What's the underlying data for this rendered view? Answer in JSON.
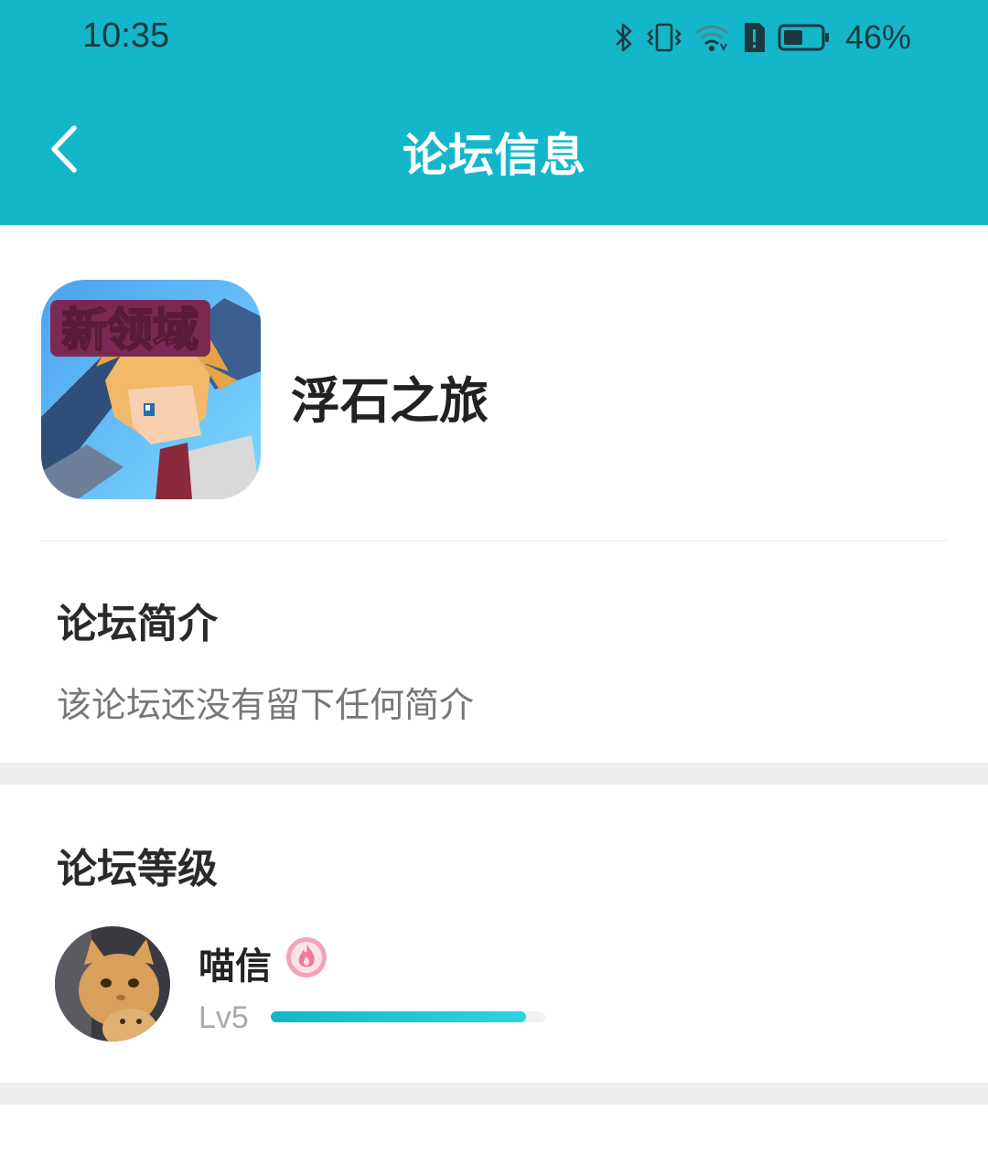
{
  "status_bar": {
    "time": "10:35",
    "battery_percent": "46%",
    "icons": [
      "bluetooth-icon",
      "vibrate-icon",
      "wifi-icon",
      "alert-icon",
      "battery-icon"
    ]
  },
  "header": {
    "title": "论坛信息",
    "back_icon": "chevron-left-icon",
    "background_color": "#14b7c9"
  },
  "forum": {
    "name": "浮石之旅",
    "icon_banner_text": "新领域"
  },
  "intro": {
    "title": "论坛简介",
    "text": "该论坛还没有留下任何简介"
  },
  "level": {
    "title": "论坛等级",
    "user_name": "喵信",
    "level_label": "Lv5",
    "progress": 0.93,
    "badge_icon": "flame-badge-icon"
  }
}
